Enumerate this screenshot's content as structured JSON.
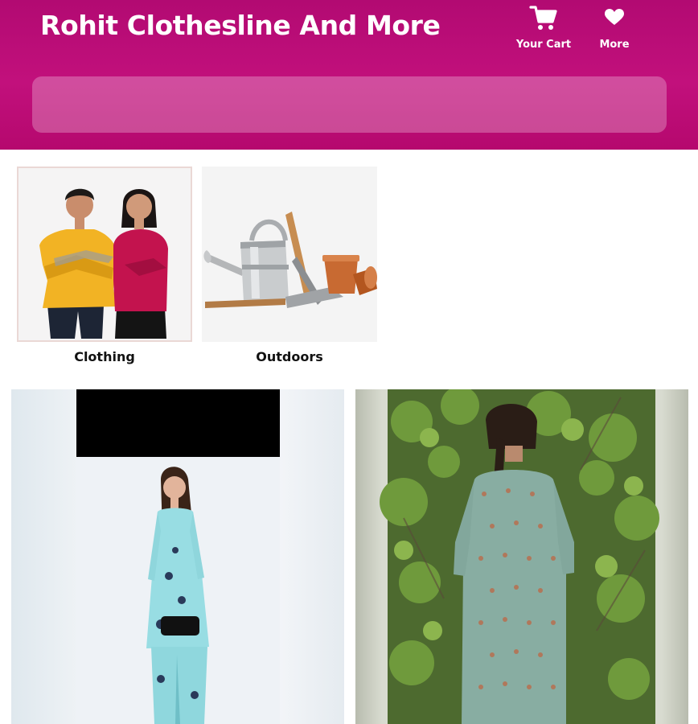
{
  "header": {
    "title": "Rohit Clothesline And More",
    "cart_label": "Your Cart",
    "more_label": "More",
    "cart_icon": "shopping-cart-icon",
    "more_icon": "heart-icon"
  },
  "search": {
    "placeholder": ""
  },
  "categories": [
    {
      "label": "Clothing",
      "image": "couple-in-sweaters"
    },
    {
      "label": "Outdoors",
      "image": "garden-tools-watering-can"
    }
  ],
  "products": [
    {
      "image": "woman-in-aqua-kurta-set"
    },
    {
      "image": "woman-in-green-printed-kurta-back-view"
    }
  ],
  "colors": {
    "header": "#c2107c",
    "text_on_header": "#ffffff"
  }
}
